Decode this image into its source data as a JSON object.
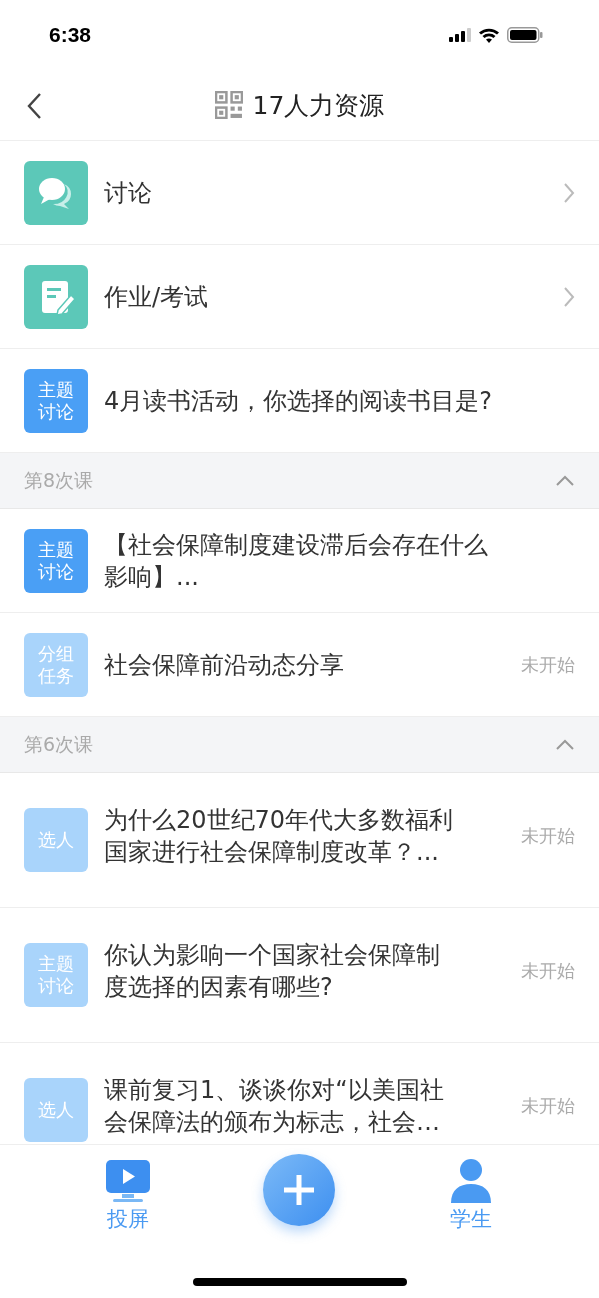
{
  "status_bar": {
    "time": "6:38"
  },
  "nav": {
    "title": "17人力资源"
  },
  "menu": [
    {
      "kind": "discussion",
      "label": "讨论"
    },
    {
      "kind": "homework",
      "label": "作业/考试"
    }
  ],
  "pinned": [
    {
      "badge": "主题讨论",
      "title": "4月读书活动，你选择的阅读书目是?",
      "active": true
    }
  ],
  "sections": [
    {
      "title": "第8次课",
      "expanded": true,
      "items": [
        {
          "badge": "主题讨论",
          "title": "【社会保障制度建设滞后会存在什么影响】...",
          "active": true
        },
        {
          "badge": "分组任务",
          "title": "社会保障前沿动态分享",
          "status": "未开始",
          "active": false
        }
      ]
    },
    {
      "title": "第6次课",
      "expanded": true,
      "items": [
        {
          "badge": "选人",
          "title": "为什么20世纪70年代大多数福利国家进行社会保障制度改革？...",
          "status": "未开始",
          "active": false
        },
        {
          "badge": "主题讨论",
          "title": "你认为影响一个国家社会保障制度选择的因素有哪些?",
          "status": "未开始",
          "active": false
        },
        {
          "badge": "选人",
          "title": "课前复习1、谈谈你对“以美国社会保障法的颁布为标志，社会…",
          "status": "未开始",
          "active": false
        }
      ]
    }
  ],
  "tab_bar": [
    {
      "kind": "screen",
      "label": "投屏"
    },
    {
      "kind": "add"
    },
    {
      "kind": "student",
      "label": "学生"
    }
  ]
}
